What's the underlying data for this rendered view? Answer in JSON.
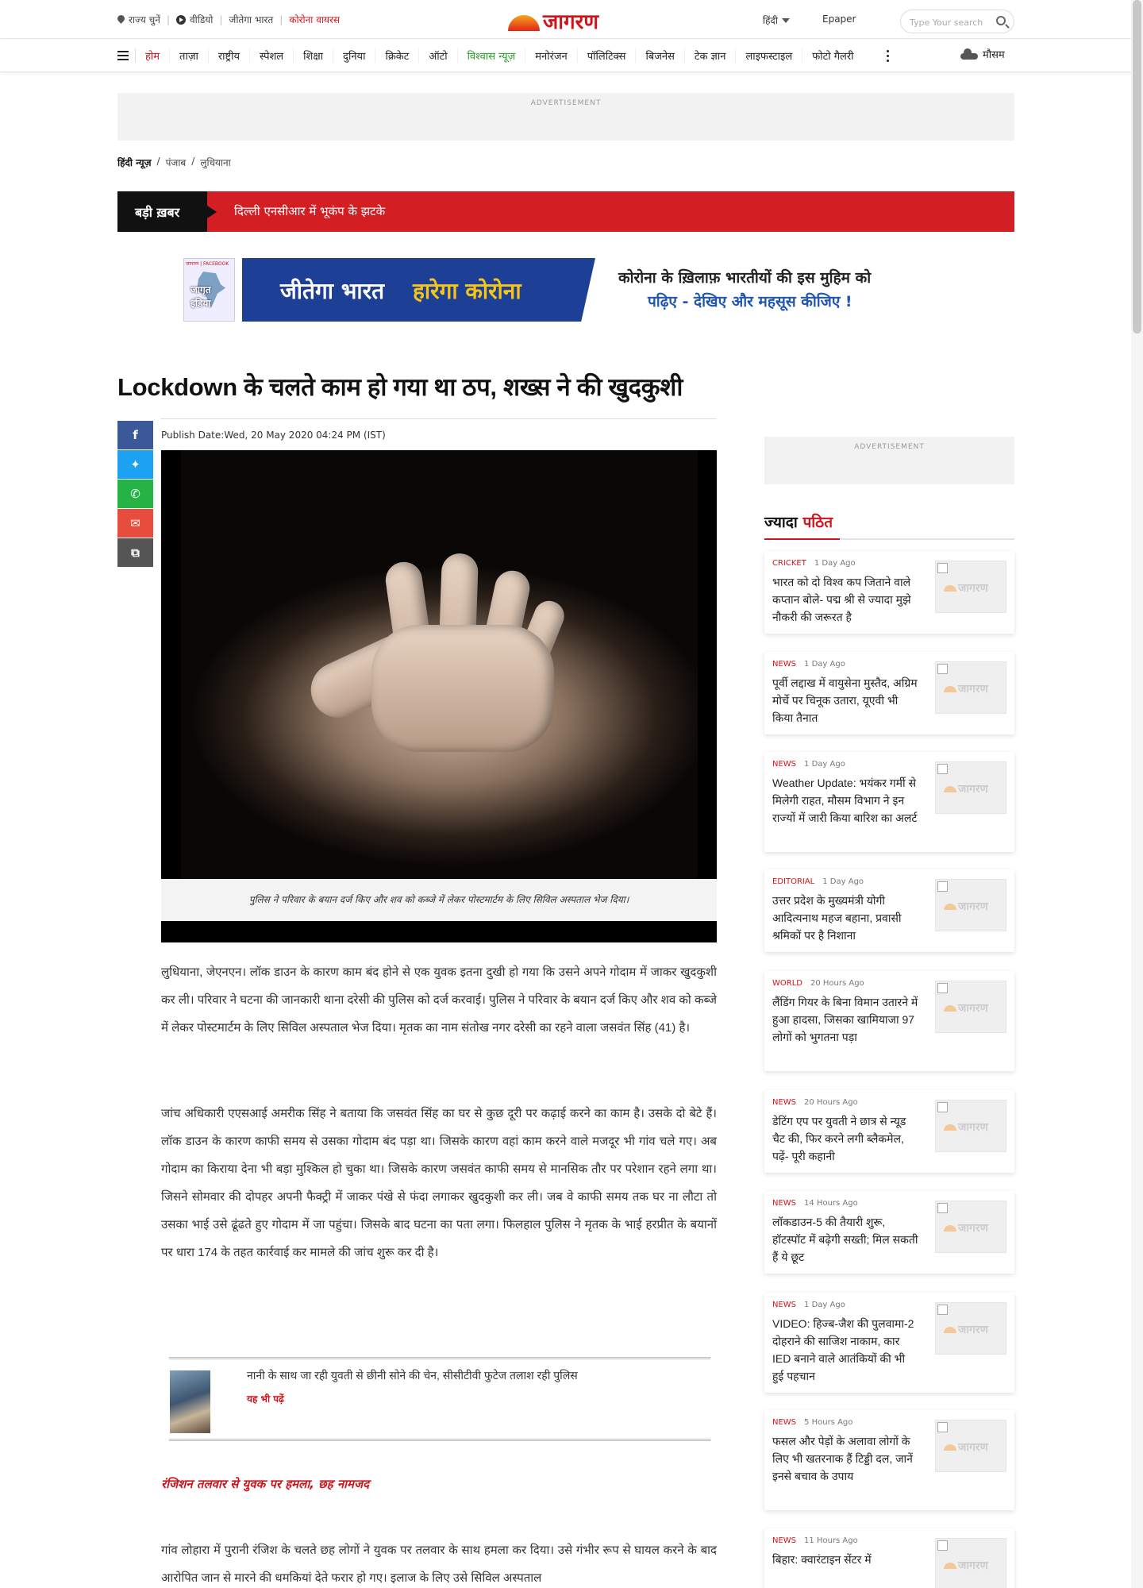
{
  "top": {
    "links": [
      "राज्य चुनें",
      "वीडियो",
      "जीतेगा भारत",
      "कोरोना वायरस"
    ],
    "logo": "जागरण",
    "language": "हिंदी",
    "epaper": "Epaper",
    "search_placeholder": "Type Your search"
  },
  "nav": {
    "items": [
      "होम",
      "ताज़ा",
      "राष्ट्रीय",
      "स्पेशल",
      "शिक्षा",
      "दुनिया",
      "क्रिकेट",
      "ऑटो",
      "विश्वास न्यूज़",
      "मनोरंजन",
      "पॉलिटिक्स",
      "बिजनेस",
      "टेक ज्ञान",
      "लाइफस्टाइल",
      "फोटो गैलरी"
    ],
    "weather": "मौसम"
  },
  "ads": {
    "label": "ADVERTISEMENT"
  },
  "breadcrumb": [
    "हिंदी न्यूज़",
    "/",
    "पंजाब",
    "/",
    "लुधियाना"
  ],
  "breaking": {
    "label": "बड़ी ख़बर",
    "text": "दिल्ली एनसीआर में भूकंप के झटके"
  },
  "promo": {
    "badge_top": "जागरण | FACEBOOK",
    "badge_text": "जागृत इंडिया",
    "banner_a": "जीतेगा भारत",
    "banner_b": "हारेगा कोरोना",
    "line1": "कोरोना के ख़िलाफ़ भारतीयों की इस मुहिम को",
    "line2": "पढ़िए - देखिए और महसूस कीजिए !"
  },
  "article": {
    "title": "Lockdown के चलते काम हो गया था ठप, शख्स ने की खुदकुशी",
    "publish": "Publish Date:Wed, 20 May 2020 04:24 PM (IST)",
    "caption": "पुलिस ने परिवार के बयान दर्ज किए और शव को कब्जे में लेकर पोस्टमार्टम के लिए सिविल अस्पताल भेज दिया।",
    "p1": "लुधियाना, जेएनएन। लॉक डाउन के कारण काम बंद होने से एक युवक इतना दुखी हो गया कि उसने अपने गोदाम में जाकर खुदकुशी कर ली। परिवार ने घटना की जानकारी थाना दरेसी की पुलिस को दर्ज करवाई। पुलिस ने परिवार के बयान दर्ज किए और शव को कब्जे में लेकर पोस्टमार्टम के लिए सिविल अस्पताल भेज दिया। मृतक का नाम संतोख नगर दरेसी का रहने वाला जसवंत सिंह (41) है।",
    "p2": "जांच अधिकारी एएसआई अमरीक सिंह ने बताया कि जसवंत सिंह का घर से कुछ दूरी पर कढ़ाई करने का काम है। उसके दो बेटे हैं। लॉक डाउन के कारण काफी समय से उसका गोदाम बंद पड़ा था। जिसके कारण वहां काम करने वाले मजदूर भी गांव चले गए। अब गोदाम का किराया देना भी बड़ा मुश्किल हो चुका था। जिसके कारण जसवंत काफी समय से मानसिक तौर पर परेशान रहने लगा था। जिसने सोमवार की दोपहर अपनी फैक्ट्री में जाकर पंखे से फंदा लगाकर खुदकुशी कर ली। जब वे काफी समय तक घर ना लौटा तो उसका भाई उसे ढूंढते हुए गोदाम में जा पहुंचा। जिसके बाद घटना का पता लगा। फिलहाल पुलिस ने मृतक के भाई हरप्रीत के बयानों पर धारा 174 के तहत कार्रवाई कर मामले की जांच शुरू कर दी है।",
    "also_text": "नानी के साथ जा रही युवती से छीनी सोने की चेन, सीसीटीवी फुटेज तलाश रही पुलिस",
    "also_label": "यह भी पढ़ें",
    "subheading": "रंजिशन तलवार से युवक पर हमला, छह नामजद",
    "p3": "गांव लोहारा में पुरानी रंजिश के चलते छह लोगों ने युवक पर तलवार के साथ हमला कर दिया। उसे गंभीर रूप से घायल करने के बाद आरोपित जान से मारने की धमकियां देते फरार हो गए। इलाज के लिए उसे सिविल अस्पताल"
  },
  "sidebar": {
    "heading_a": "ज्यादा",
    "heading_b": "पठित",
    "thumb_logo": "जागरण",
    "cards": [
      {
        "cat": "CRICKET",
        "time": "1 Day Ago",
        "title": "भारत को दो विश्व कप जिताने वाले कप्तान बोले- पद्म श्री से ज्यादा मुझे नौकरी की जरूरत है"
      },
      {
        "cat": "NEWS",
        "time": "1 Day Ago",
        "title": "पूर्वी लद्दाख में वायुसेना मुस्तैद, अग्रिम मोर्चे पर चिनूक उतारा, यूएवी भी किया तैनात"
      },
      {
        "cat": "NEWS",
        "time": "1 Day Ago",
        "title": "Weather Update: भयंकर गर्मी से मिलेगी राहत, मौसम विभाग ने इन राज्यों में जारी किया बारिश का अलर्ट"
      },
      {
        "cat": "EDITORIAL",
        "time": "1 Day Ago",
        "title": "उत्तर प्रदेश के मुख्यमंत्री योगी आदित्यनाथ महज बहाना, प्रवासी श्रमिकों पर है निशाना"
      },
      {
        "cat": "WORLD",
        "time": "20 Hours Ago",
        "title": "लैंडिंग गियर के बिना विमान उतारने में हुआ हादसा, जिसका खामियाजा 97 लोगों को भुगतना पड़ा"
      },
      {
        "cat": "NEWS",
        "time": "20 Hours Ago",
        "title": "डेटिंग एप पर युवती ने छात्र से न्यूड चैट की, फिर करने लगी ब्लैकमेल, पढ़ें- पूरी कहानी"
      },
      {
        "cat": "NEWS",
        "time": "14 Hours Ago",
        "title": "लॉकडाउन-5 की तैयारी शुरू, हॉटस्पॉट में बढ़ेगी सख्ती; मिल सकती हैं ये छूट"
      },
      {
        "cat": "NEWS",
        "time": "1 Day Ago",
        "title": "VIDEO: हिज्ब-जैश की पुलवामा-2 दोहराने की साजिश नाकाम, कार IED बनाने वाले आतंकियों की भी हुई पहचान"
      },
      {
        "cat": "NEWS",
        "time": "5 Hours Ago",
        "title": "फसल और पेड़ों के अलावा लोगों के लिए भी खतरनाक हैं टिड्डी दल, जानें इनसे बचाव के उपाय"
      },
      {
        "cat": "NEWS",
        "time": "11 Hours Ago",
        "title": "बिहार: क्वारंटाइन सेंटर में"
      }
    ]
  }
}
